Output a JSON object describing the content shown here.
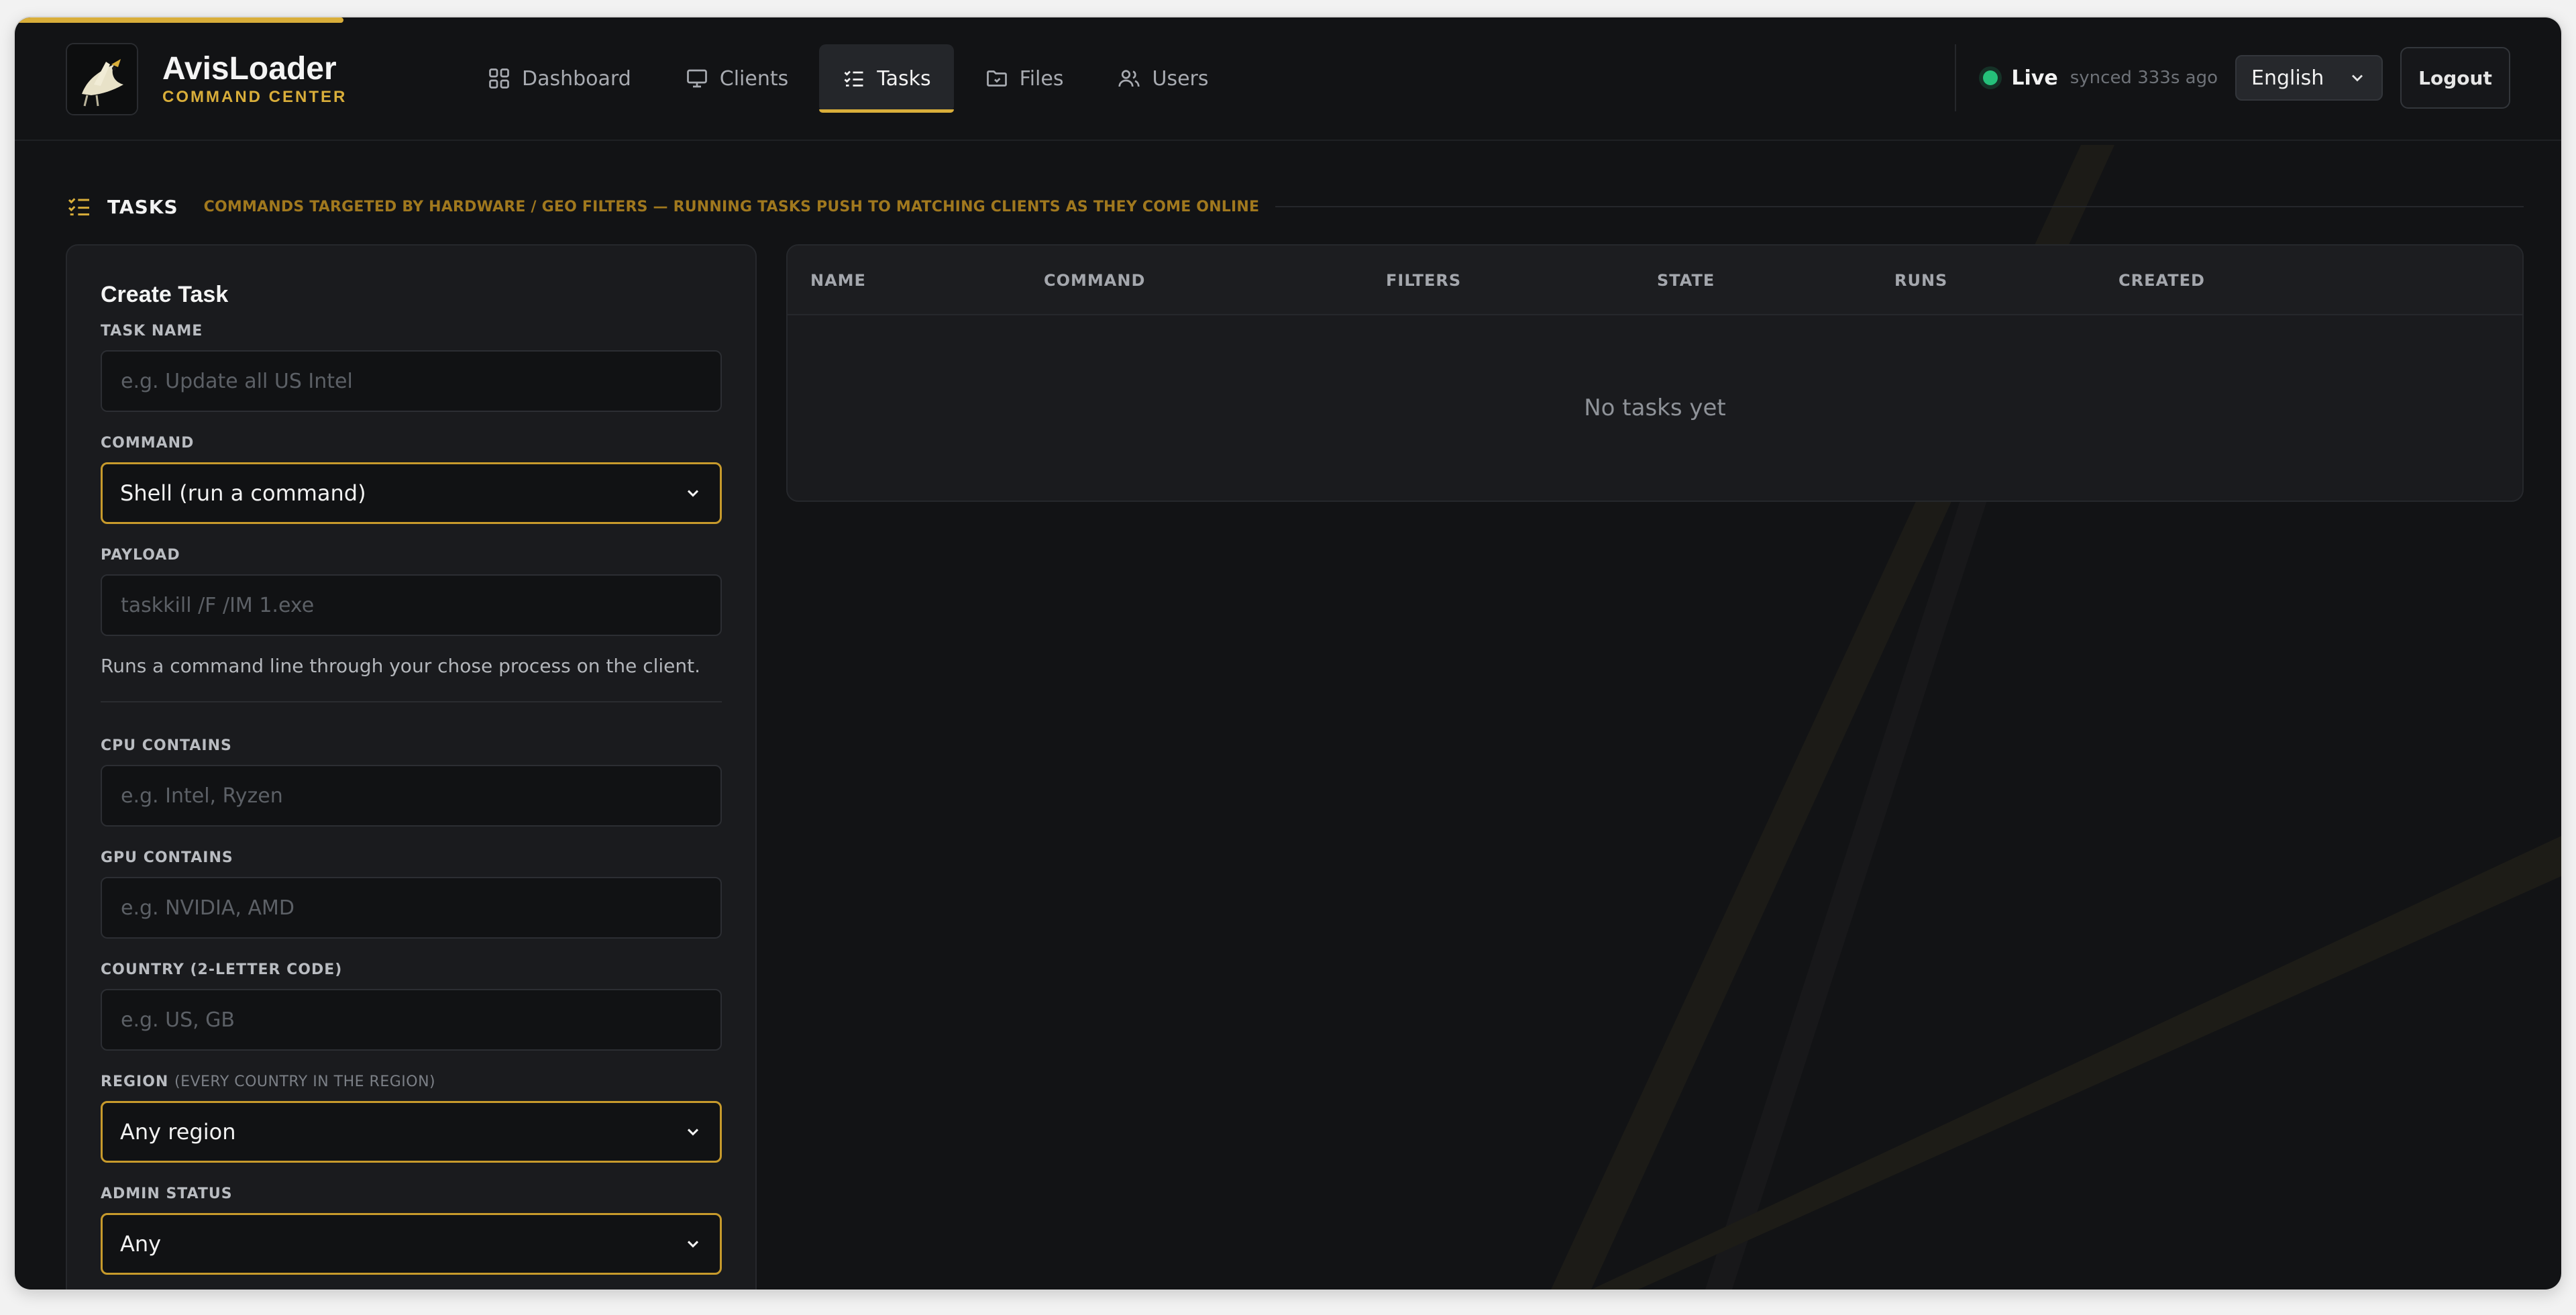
{
  "brand": {
    "name": "AvisLoader",
    "subtitle": "COMMAND CENTER"
  },
  "nav": {
    "tabs": [
      {
        "label": "Dashboard",
        "icon": "grid-icon",
        "active": false
      },
      {
        "label": "Clients",
        "icon": "monitor-icon",
        "active": false
      },
      {
        "label": "Tasks",
        "icon": "tasks-icon",
        "active": true
      },
      {
        "label": "Files",
        "icon": "folder-icon",
        "active": false
      },
      {
        "label": "Users",
        "icon": "users-icon",
        "active": false
      }
    ]
  },
  "status": {
    "live_label": "Live",
    "synced_text": "synced 333s ago",
    "live_color": "#25c07a"
  },
  "language": {
    "selected": "English"
  },
  "logout_label": "Logout",
  "section": {
    "title": "TASKS",
    "description": "COMMANDS TARGETED BY HARDWARE / GEO FILTERS — RUNNING TASKS PUSH TO MATCHING CLIENTS AS THEY COME ONLINE"
  },
  "create_task": {
    "title": "Create Task",
    "task_name": {
      "label": "TASK NAME",
      "placeholder": "e.g. Update all US Intel",
      "value": ""
    },
    "command": {
      "label": "COMMAND",
      "selected": "Shell (run a command)"
    },
    "payload": {
      "label": "PAYLOAD",
      "placeholder": "taskkill /F /IM 1.exe",
      "value": ""
    },
    "help_text": "Runs a command line through your chose process on the client.",
    "cpu": {
      "label": "CPU CONTAINS",
      "placeholder": "e.g. Intel, Ryzen",
      "value": ""
    },
    "gpu": {
      "label": "GPU CONTAINS",
      "placeholder": "e.g. NVIDIA, AMD",
      "value": ""
    },
    "country": {
      "label": "COUNTRY (2-LETTER CODE)",
      "placeholder": "e.g. US, GB",
      "value": ""
    },
    "region": {
      "label": "REGION",
      "label_note": "(EVERY COUNTRY IN THE REGION)",
      "selected": "Any region"
    },
    "admin": {
      "label": "ADMIN STATUS",
      "selected": "Any"
    }
  },
  "tasks_table": {
    "columns": [
      "NAME",
      "COMMAND",
      "FILTERS",
      "STATE",
      "RUNS",
      "CREATED"
    ],
    "rows": [],
    "empty_text": "No tasks yet"
  },
  "colors": {
    "accent": "#d9ae3a",
    "background": "#121315",
    "panel": "#1a1b1e"
  }
}
